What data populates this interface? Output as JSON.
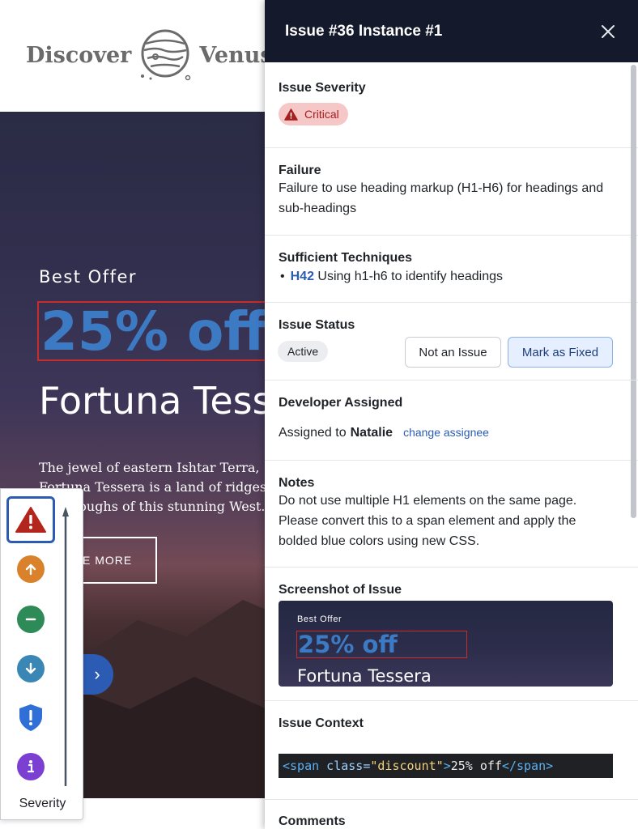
{
  "site": {
    "logo_left": "Discover",
    "logo_right": "Venus",
    "hero": {
      "eyebrow": "Best Offer",
      "discount": "25% off",
      "title": "Fortuna Tessera",
      "description": "The jewel of eastern Ishtar Terra, Fortuna Tessera is a land of ridges and troughs of this stunning West.",
      "more_button": "E MORE",
      "next_glyph": "›"
    }
  },
  "severity_legend": {
    "label": "Severity",
    "levels": [
      {
        "name": "critical",
        "color": "#b3261e",
        "glyph": "!"
      },
      {
        "name": "serious",
        "color": "#d9822b",
        "glyph": "↑"
      },
      {
        "name": "moderate",
        "color": "#2e8b57",
        "glyph": "−"
      },
      {
        "name": "minor",
        "color": "#3a86b4",
        "glyph": "↓"
      },
      {
        "name": "best-practice",
        "color": "#2f6fd6",
        "glyph": "!"
      },
      {
        "name": "info",
        "color": "#7b3fd1",
        "glyph": "i"
      }
    ]
  },
  "panel": {
    "title": "Issue #36 Instance #1",
    "severity": {
      "heading": "Issue Severity",
      "badge": "Critical"
    },
    "failure": {
      "heading": "Failure",
      "text": "Failure to use heading markup (H1-H6) for headings and sub-headings"
    },
    "techniques": {
      "heading": "Sufficient Techniques",
      "items": [
        {
          "code": "H42",
          "text": "Using h1-h6 to identify headings"
        }
      ]
    },
    "status": {
      "heading": "Issue Status",
      "value": "Active",
      "not_issue_label": "Not an Issue",
      "mark_fixed_label": "Mark as Fixed"
    },
    "developer": {
      "heading": "Developer Assigned",
      "prefix": "Assigned to",
      "name": "Natalie",
      "change_label": "change assignee"
    },
    "notes": {
      "heading": "Notes",
      "text": "Do not use multiple H1 elements on the same page. Please convert this to a span element and apply the bolded blue colors using new CSS."
    },
    "screenshot": {
      "heading": "Screenshot of Issue",
      "eyebrow": "Best Offer",
      "discount": "25% off",
      "title": "Fortuna Tessera"
    },
    "context": {
      "heading": "Issue Context",
      "code_open_tag": "<span",
      "code_attr": " class=",
      "code_value": "\"discount\"",
      "code_close_bracket": ">",
      "code_text": "25% off",
      "code_end_tag": "</span>"
    },
    "comments": {
      "heading": "Comments"
    }
  }
}
